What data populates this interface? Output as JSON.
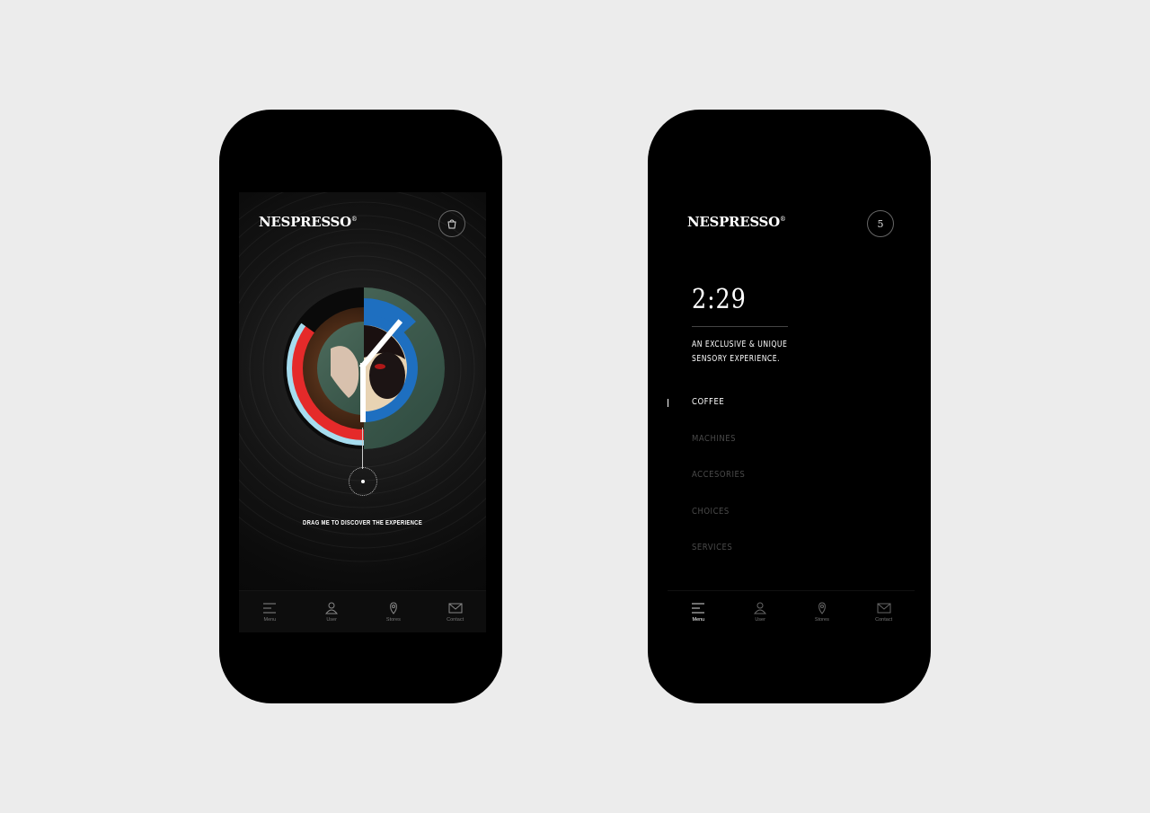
{
  "colors": {
    "background": "#ececec",
    "phone": "#000000",
    "accent_red": "#e52a2a",
    "accent_blue": "#1e6fc0",
    "accent_light_blue": "#a6dcef",
    "muted_text": "#4a4a4a"
  },
  "left": {
    "logo": "NESPRESSO",
    "logo_mark": "®",
    "cart_icon": "shopping-bag-icon",
    "drag_text": "DRAG ME TO DISCOVER THE EXPERIENCE"
  },
  "right": {
    "logo": "NESPRESSO",
    "logo_mark": "®",
    "cart_count": "5",
    "time": "2:29",
    "tagline_line1": "AN EXCLUSIVE & UNIQUE",
    "tagline_line2": "SENSORY EXPERIENCE.",
    "menu": [
      {
        "label": "COFFEE",
        "active": true
      },
      {
        "label": "MACHINES",
        "active": false
      },
      {
        "label": "ACCESORIES",
        "active": false
      },
      {
        "label": "CHOICES",
        "active": false
      },
      {
        "label": "SERVICES",
        "active": false
      }
    ]
  },
  "tabbar": [
    {
      "label": "Menu",
      "icon": "menu-icon"
    },
    {
      "label": "User",
      "icon": "user-icon"
    },
    {
      "label": "Stores",
      "icon": "location-pin-icon"
    },
    {
      "label": "Contact",
      "icon": "envelope-icon"
    }
  ]
}
